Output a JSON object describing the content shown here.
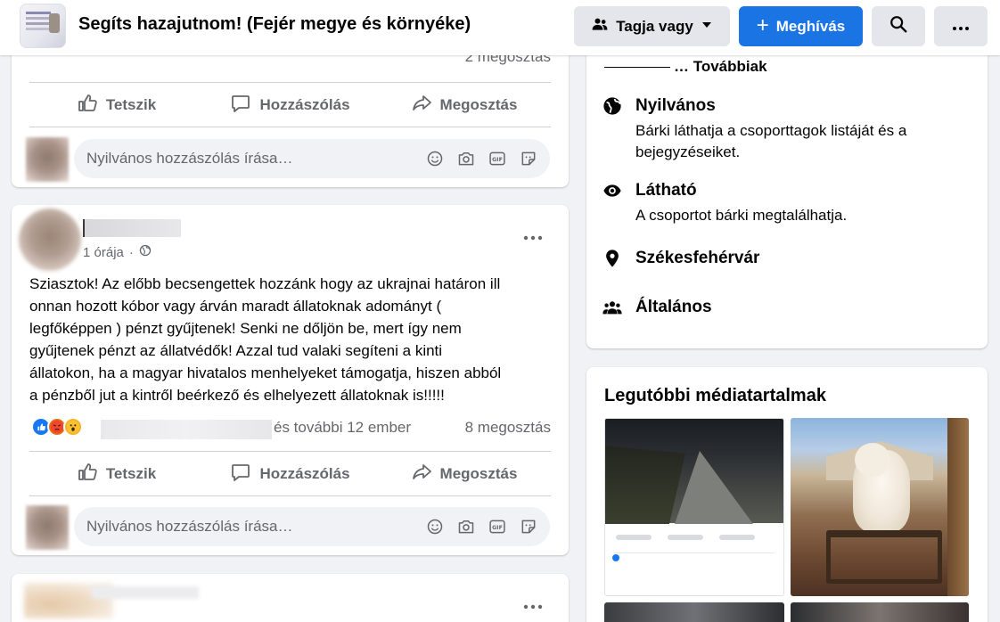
{
  "header": {
    "group_title": "Segíts hazajutnom! (Fejér megye és környéke)",
    "member_button": "Tagja vagy",
    "invite_button": "Meghívás"
  },
  "top_post": {
    "share_count": "2 megosztás",
    "actions": {
      "like": "Tetszik",
      "comment": "Hozzászólás",
      "share": "Megosztás"
    },
    "comment_placeholder": "Nyilvános hozzászólás írása…"
  },
  "main_post": {
    "time": "1 órája",
    "text": "Sziasztok! Az előbb becsengettek hozzánk hogy az ukrajnai határon ill\nonnan hozott kóbor vagy árván maradt állatoknak adományt (\nlegfőképpen ) pénzt gyűjtenek! Senki ne dőljön be, mert így nem\ngyűjtenek pénzt az állatvédők! Azzal tud valaki segíteni a kinti\nállatokon,  ha a magyar hivatalos menhelyeket támogatja, hiszen abból\na pénzből jut a kintről beérkező és elhelyezett állatoknak is!!!!!",
    "reactions_text": "és további 12 ember",
    "share_count": "8 megosztás",
    "actions": {
      "like": "Tetszik",
      "comment": "Hozzászólás",
      "share": "Megosztás"
    },
    "comment_placeholder": "Nyilvános hozzászólás írása…"
  },
  "sidebar": {
    "more_link": "… Továbbiak",
    "info": [
      {
        "icon": "globe-icon",
        "title": "Nyilvános",
        "desc": "Bárki láthatja a csoporttagok listáját és a bejegyzéseiket."
      },
      {
        "icon": "eye-icon",
        "title": "Látható",
        "desc": "A csoportot bárki megtalálhatja."
      },
      {
        "icon": "location-pin-icon",
        "title": "Székesfehérvár",
        "desc": ""
      },
      {
        "icon": "people-icon",
        "title": "Általános",
        "desc": ""
      }
    ],
    "media_title": "Legutóbbi médiatartalmak"
  },
  "colors": {
    "brand_blue": "#1b74e4",
    "secondary_text": "#65676b",
    "page_background": "#f0f2f5"
  }
}
